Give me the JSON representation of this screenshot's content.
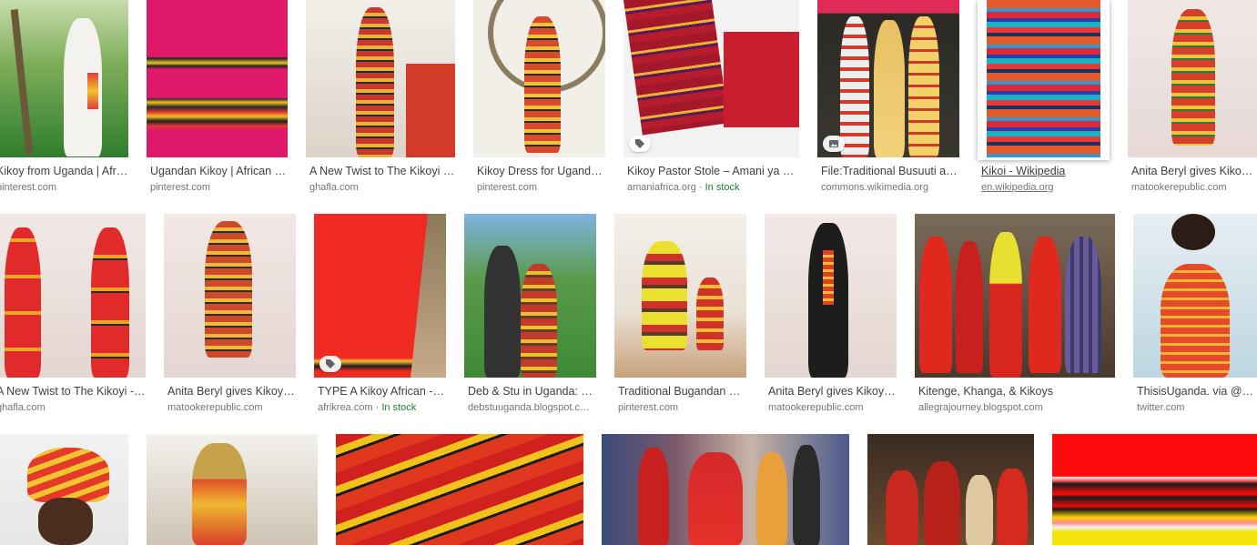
{
  "rows": [
    {
      "items": [
        {
          "caption": "Kikoy from Uganda | Afri…",
          "source": "pinterest.com"
        },
        {
          "caption": "Ugandan Kikoy | African …",
          "source": "pinterest.com"
        },
        {
          "caption": "A New Twist to The Kikoyi …",
          "source": "ghafla.com"
        },
        {
          "caption": "Kikoy Dress for Uganda…",
          "source": "pinterest.com"
        },
        {
          "caption": "Kikoy Pastor Stole – Amani ya J…",
          "source": "amaniafrica.org",
          "stock": "· In stock",
          "badge": "tag-icon"
        },
        {
          "caption": "File:Traditional Busuuti a…",
          "source": "commons.wikimedia.org",
          "badge": "image-icon"
        },
        {
          "caption": "Kikoi - Wikipedia",
          "source": "en.wikipedia.org"
        },
        {
          "caption": "Anita Beryl gives Kikoy a…",
          "source": "matookerepublic.com"
        }
      ]
    },
    {
      "items": [
        {
          "caption": "A New Twist to The Kikoyi - …",
          "source": "ghafla.com"
        },
        {
          "caption": "Anita Beryl gives Kikoy …",
          "source": "matookerepublic.com"
        },
        {
          "caption": "TYPE A Kikoy African - …",
          "source": "afrikrea.com",
          "stock": "· In stock",
          "badge": "tag-icon"
        },
        {
          "caption": "Deb & Stu in Uganda: K…",
          "source": "debstuuganda.blogspot.c…"
        },
        {
          "caption": "Traditional Bugandan D…",
          "source": "pinterest.com"
        },
        {
          "caption": "Anita Beryl gives Kikoy …",
          "source": "matookerepublic.com"
        },
        {
          "caption": "Kitenge, Khanga, & Kikoys",
          "source": "allegrajourney.blogspot.com"
        },
        {
          "caption": "ThisisUganda. via @sol…",
          "source": "twitter.com"
        }
      ]
    },
    {
      "items": [
        {
          "caption": "",
          "source": ""
        },
        {
          "caption": "",
          "source": ""
        },
        {
          "caption": "",
          "source": ""
        },
        {
          "caption": "",
          "source": ""
        },
        {
          "caption": "",
          "source": ""
        },
        {
          "caption": "",
          "source": ""
        }
      ]
    }
  ],
  "colors": {
    "caption": "#3c4043",
    "source": "#70757a",
    "in_stock": "#188038"
  }
}
